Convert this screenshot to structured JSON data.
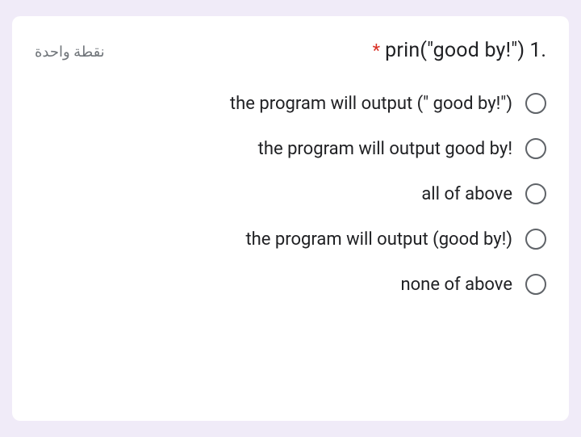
{
  "question": {
    "points_label": "نقطة واحدة",
    "number": ".1",
    "title": "prin(\"good by!\")",
    "required_marker": "*",
    "options": [
      {
        "label": "the program will output (\" good by!\")"
      },
      {
        "label": "the program will output good by!"
      },
      {
        "label": "all of above"
      },
      {
        "label": "the program will output (good by!)"
      },
      {
        "label": "none of above"
      }
    ]
  }
}
